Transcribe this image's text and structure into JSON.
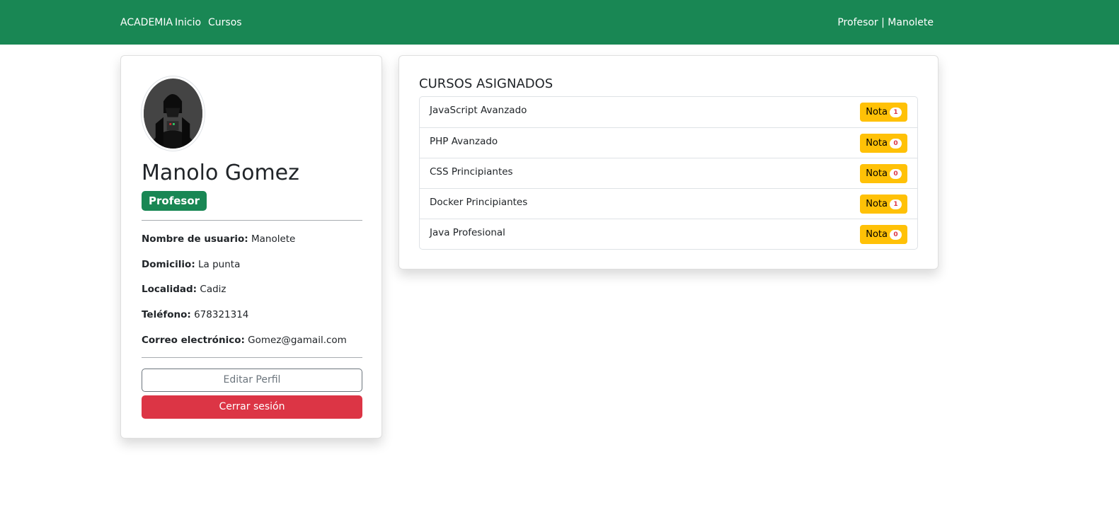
{
  "navbar": {
    "brand": "ACADEMIA",
    "links": [
      "Inicio",
      "Cursos"
    ],
    "user": "Profesor | Manolete",
    "color": "#198754"
  },
  "profile": {
    "name": "Manolo Gomez",
    "role": "Profesor",
    "fields": [
      {
        "label": "Nombre de usuario:",
        "value": "Manolete"
      },
      {
        "label": "Domicilio:",
        "value": "La punta"
      },
      {
        "label": "Localidad:",
        "value": "Cadiz"
      },
      {
        "label": "Teléfono:",
        "value": "678321314"
      },
      {
        "label": "Correo electrónico:",
        "value": "Gomez@gamail.com"
      }
    ],
    "edit_label": "Editar Perfil",
    "logout_label": "Cerrar sesión"
  },
  "courses": {
    "title": "CURSOS ASIGNADOS",
    "nota_label": "Nota",
    "items": [
      {
        "name": "JavaScript Avanzado",
        "count": "1"
      },
      {
        "name": "PHP Avanzado",
        "count": "0"
      },
      {
        "name": "CSS Principiantes",
        "count": "0"
      },
      {
        "name": "Docker Principiantes",
        "count": "1"
      },
      {
        "name": "Java Profesional",
        "count": "0"
      }
    ]
  },
  "colors": {
    "primary": "#198754",
    "danger": "#dc3545",
    "warning": "#ffc107",
    "secondary": "#6c757d"
  }
}
